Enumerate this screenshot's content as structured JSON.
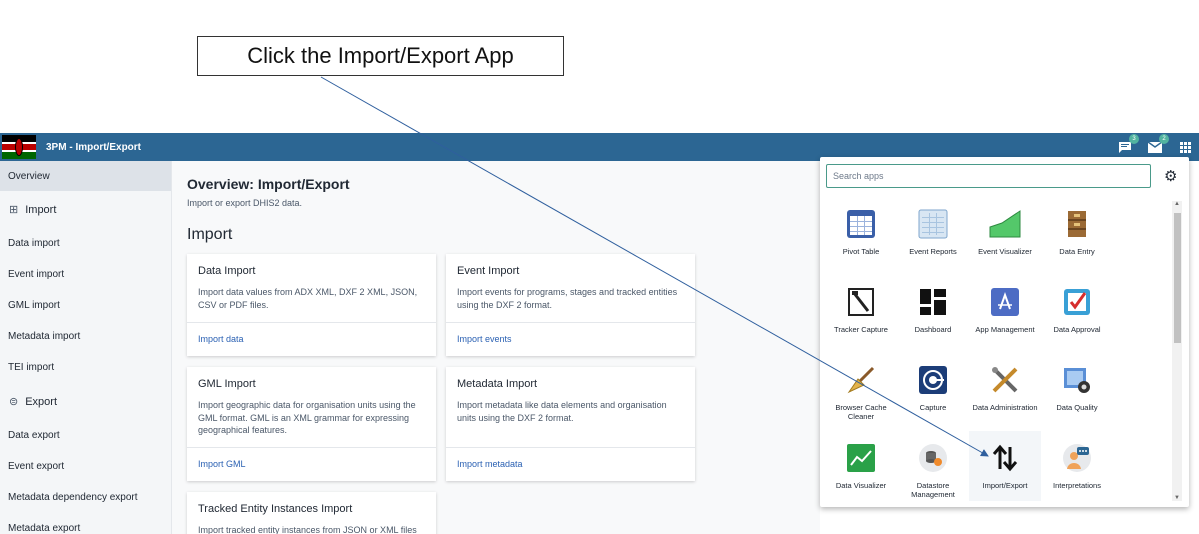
{
  "callout": {
    "text": "Click the Import/Export App"
  },
  "header": {
    "app_title": "3PM - Import/Export",
    "messages_badge": "3",
    "mail_badge": "2",
    "icons": [
      "message-icon",
      "mail-icon",
      "apps-grid-icon"
    ]
  },
  "sidebar": {
    "overview": "Overview",
    "import_section": "Import",
    "import_items": [
      "Data import",
      "Event import",
      "GML import",
      "Metadata import",
      "TEI import"
    ],
    "export_section": "Export",
    "export_items": [
      "Data export",
      "Event export",
      "Metadata dependency export",
      "Metadata export"
    ]
  },
  "main": {
    "title": "Overview: Import/Export",
    "subtitle": "Import or export DHIS2 data.",
    "section": "Import",
    "cards": [
      {
        "title": "Data Import",
        "desc": "Import data values from ADX XML, DXF 2 XML, JSON, CSV or PDF files.",
        "link": "Import data"
      },
      {
        "title": "Event Import",
        "desc": "Import events for programs, stages and tracked entities using the DXF 2 format.",
        "link": "Import events"
      },
      {
        "title": "GML Import",
        "desc": "Import geographic data for organisation units using the GML format. GML is an XML grammar for expressing geographical features.",
        "link": "Import GML"
      },
      {
        "title": "Metadata Import",
        "desc": "Import metadata like data elements and organisation units using the DXF 2 format.",
        "link": "Import metadata"
      },
      {
        "title": "Tracked Entity Instances Import",
        "desc": "Import tracked entity instances from JSON or XML files"
      }
    ]
  },
  "apps_panel": {
    "search_placeholder": "Search apps",
    "apps": [
      {
        "label": "Pivot Table",
        "icon": "pivot-table-icon"
      },
      {
        "label": "Event Reports",
        "icon": "event-reports-icon"
      },
      {
        "label": "Event Visualizer",
        "icon": "event-visualizer-icon"
      },
      {
        "label": "Data Entry",
        "icon": "data-entry-icon"
      },
      {
        "label": "Tracker Capture",
        "icon": "tracker-capture-icon"
      },
      {
        "label": "Dashboard",
        "icon": "dashboard-icon"
      },
      {
        "label": "App Management",
        "icon": "app-management-icon"
      },
      {
        "label": "Data Approval",
        "icon": "data-approval-icon"
      },
      {
        "label": "Browser Cache Cleaner",
        "icon": "browser-cache-cleaner-icon"
      },
      {
        "label": "Capture",
        "icon": "capture-icon"
      },
      {
        "label": "Data Administration",
        "icon": "data-administration-icon"
      },
      {
        "label": "Data Quality",
        "icon": "data-quality-icon"
      },
      {
        "label": "Data Visualizer",
        "icon": "data-visualizer-icon"
      },
      {
        "label": "Datastore Management",
        "icon": "datastore-management-icon"
      },
      {
        "label": "Import/Export",
        "icon": "import-export-icon"
      },
      {
        "label": "Interpretations",
        "icon": "interpretations-icon"
      }
    ]
  },
  "colors": {
    "header_bg": "#2c6693",
    "link": "#2b61b3",
    "accent": "#52b4a0",
    "sidebar_active": "#dde2e8"
  }
}
